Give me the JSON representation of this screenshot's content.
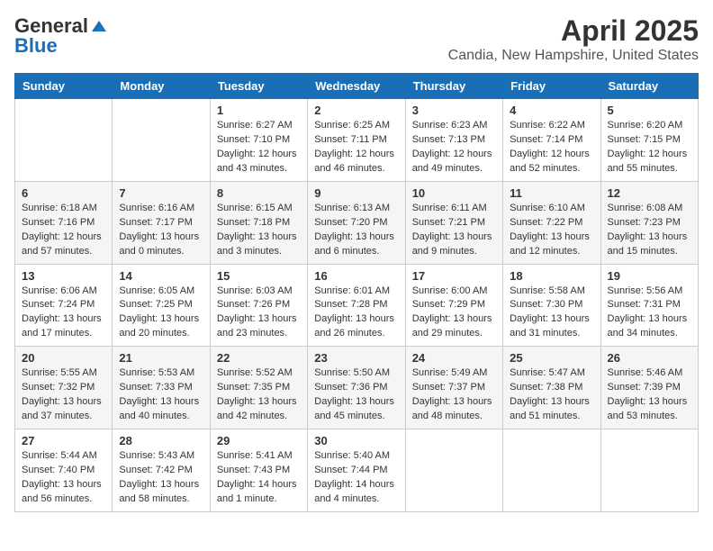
{
  "logo": {
    "line1": "General",
    "line2": "Blue"
  },
  "title": "April 2025",
  "subtitle": "Candia, New Hampshire, United States",
  "weekdays": [
    "Sunday",
    "Monday",
    "Tuesday",
    "Wednesday",
    "Thursday",
    "Friday",
    "Saturday"
  ],
  "weeks": [
    [
      {
        "day": "",
        "content": ""
      },
      {
        "day": "",
        "content": ""
      },
      {
        "day": "1",
        "content": "Sunrise: 6:27 AM\nSunset: 7:10 PM\nDaylight: 12 hours and 43 minutes."
      },
      {
        "day": "2",
        "content": "Sunrise: 6:25 AM\nSunset: 7:11 PM\nDaylight: 12 hours and 46 minutes."
      },
      {
        "day": "3",
        "content": "Sunrise: 6:23 AM\nSunset: 7:13 PM\nDaylight: 12 hours and 49 minutes."
      },
      {
        "day": "4",
        "content": "Sunrise: 6:22 AM\nSunset: 7:14 PM\nDaylight: 12 hours and 52 minutes."
      },
      {
        "day": "5",
        "content": "Sunrise: 6:20 AM\nSunset: 7:15 PM\nDaylight: 12 hours and 55 minutes."
      }
    ],
    [
      {
        "day": "6",
        "content": "Sunrise: 6:18 AM\nSunset: 7:16 PM\nDaylight: 12 hours and 57 minutes."
      },
      {
        "day": "7",
        "content": "Sunrise: 6:16 AM\nSunset: 7:17 PM\nDaylight: 13 hours and 0 minutes."
      },
      {
        "day": "8",
        "content": "Sunrise: 6:15 AM\nSunset: 7:18 PM\nDaylight: 13 hours and 3 minutes."
      },
      {
        "day": "9",
        "content": "Sunrise: 6:13 AM\nSunset: 7:20 PM\nDaylight: 13 hours and 6 minutes."
      },
      {
        "day": "10",
        "content": "Sunrise: 6:11 AM\nSunset: 7:21 PM\nDaylight: 13 hours and 9 minutes."
      },
      {
        "day": "11",
        "content": "Sunrise: 6:10 AM\nSunset: 7:22 PM\nDaylight: 13 hours and 12 minutes."
      },
      {
        "day": "12",
        "content": "Sunrise: 6:08 AM\nSunset: 7:23 PM\nDaylight: 13 hours and 15 minutes."
      }
    ],
    [
      {
        "day": "13",
        "content": "Sunrise: 6:06 AM\nSunset: 7:24 PM\nDaylight: 13 hours and 17 minutes."
      },
      {
        "day": "14",
        "content": "Sunrise: 6:05 AM\nSunset: 7:25 PM\nDaylight: 13 hours and 20 minutes."
      },
      {
        "day": "15",
        "content": "Sunrise: 6:03 AM\nSunset: 7:26 PM\nDaylight: 13 hours and 23 minutes."
      },
      {
        "day": "16",
        "content": "Sunrise: 6:01 AM\nSunset: 7:28 PM\nDaylight: 13 hours and 26 minutes."
      },
      {
        "day": "17",
        "content": "Sunrise: 6:00 AM\nSunset: 7:29 PM\nDaylight: 13 hours and 29 minutes."
      },
      {
        "day": "18",
        "content": "Sunrise: 5:58 AM\nSunset: 7:30 PM\nDaylight: 13 hours and 31 minutes."
      },
      {
        "day": "19",
        "content": "Sunrise: 5:56 AM\nSunset: 7:31 PM\nDaylight: 13 hours and 34 minutes."
      }
    ],
    [
      {
        "day": "20",
        "content": "Sunrise: 5:55 AM\nSunset: 7:32 PM\nDaylight: 13 hours and 37 minutes."
      },
      {
        "day": "21",
        "content": "Sunrise: 5:53 AM\nSunset: 7:33 PM\nDaylight: 13 hours and 40 minutes."
      },
      {
        "day": "22",
        "content": "Sunrise: 5:52 AM\nSunset: 7:35 PM\nDaylight: 13 hours and 42 minutes."
      },
      {
        "day": "23",
        "content": "Sunrise: 5:50 AM\nSunset: 7:36 PM\nDaylight: 13 hours and 45 minutes."
      },
      {
        "day": "24",
        "content": "Sunrise: 5:49 AM\nSunset: 7:37 PM\nDaylight: 13 hours and 48 minutes."
      },
      {
        "day": "25",
        "content": "Sunrise: 5:47 AM\nSunset: 7:38 PM\nDaylight: 13 hours and 51 minutes."
      },
      {
        "day": "26",
        "content": "Sunrise: 5:46 AM\nSunset: 7:39 PM\nDaylight: 13 hours and 53 minutes."
      }
    ],
    [
      {
        "day": "27",
        "content": "Sunrise: 5:44 AM\nSunset: 7:40 PM\nDaylight: 13 hours and 56 minutes."
      },
      {
        "day": "28",
        "content": "Sunrise: 5:43 AM\nSunset: 7:42 PM\nDaylight: 13 hours and 58 minutes."
      },
      {
        "day": "29",
        "content": "Sunrise: 5:41 AM\nSunset: 7:43 PM\nDaylight: 14 hours and 1 minute."
      },
      {
        "day": "30",
        "content": "Sunrise: 5:40 AM\nSunset: 7:44 PM\nDaylight: 14 hours and 4 minutes."
      },
      {
        "day": "",
        "content": ""
      },
      {
        "day": "",
        "content": ""
      },
      {
        "day": "",
        "content": ""
      }
    ]
  ]
}
